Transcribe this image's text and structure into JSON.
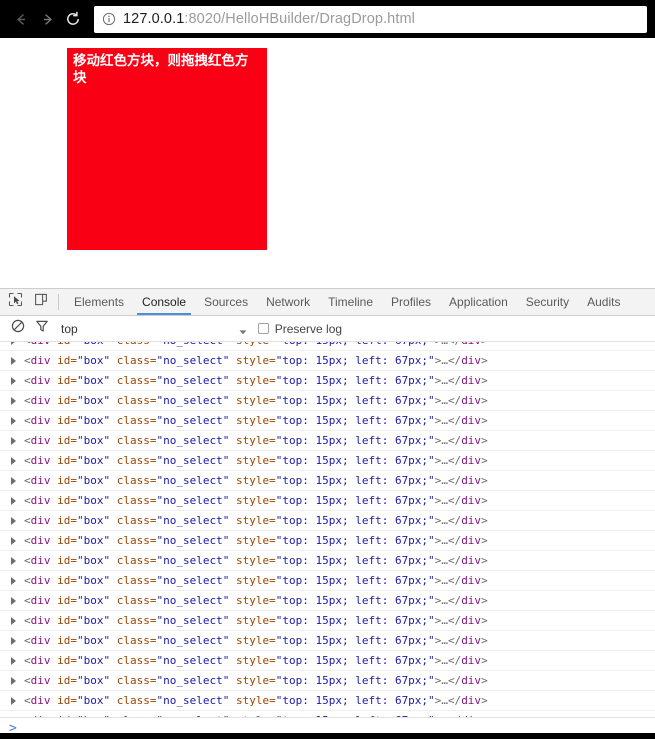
{
  "browser": {
    "back_icon": "arrow-left-icon",
    "forward_icon": "arrow-right-icon",
    "reload_icon": "reload-icon",
    "info_icon": "info-circle-icon",
    "url_host": "127.0.0.1",
    "url_rest": ":8020/HelloHBuilder/DragDrop.html",
    "url_full": "127.0.0.1:8020/HelloHBuilder/DragDrop.html"
  },
  "page": {
    "box_text": "移动红色方块，则拖拽红色方块",
    "box_color": "#fa0014",
    "box_text_color": "#ffffff"
  },
  "devtools": {
    "inspect_icon": "inspect-cursor-icon",
    "device_icon": "device-toolbar-icon",
    "tabs": [
      {
        "label": "Elements",
        "active": false
      },
      {
        "label": "Console",
        "active": true
      },
      {
        "label": "Sources",
        "active": false
      },
      {
        "label": "Network",
        "active": false
      },
      {
        "label": "Timeline",
        "active": false
      },
      {
        "label": "Profiles",
        "active": false
      },
      {
        "label": "Application",
        "active": false
      },
      {
        "label": "Security",
        "active": false
      },
      {
        "label": "Audits",
        "active": false
      }
    ],
    "active_tab_underline_color": "#4a90d9",
    "filterbar": {
      "clear_icon": "clear-console-icon",
      "filter_icon": "funnel-filter-icon",
      "context": "top",
      "context_arrow_icon": "chevron-down-icon",
      "preserve_log_label": "Preserve log",
      "preserve_log_checked": false
    },
    "console": {
      "prompt_caret": ">",
      "expander_icon": "triangle-right-icon",
      "log_entry": {
        "t1": "<",
        "tag_open": "div",
        "sp1": " ",
        "attr1": "id=",
        "val1": "\"box\"",
        "sp2": " ",
        "attr2": "class=",
        "val2": "\"no_select\"",
        "sp3": " ",
        "attr3": "style=",
        "val3": "\"top: 15px; left: 67px;\"",
        "t2": ">",
        "ellipsis": "…",
        "t3": "</",
        "tag_close": "div",
        "t4": ">"
      },
      "repeat_count": 20
    }
  }
}
